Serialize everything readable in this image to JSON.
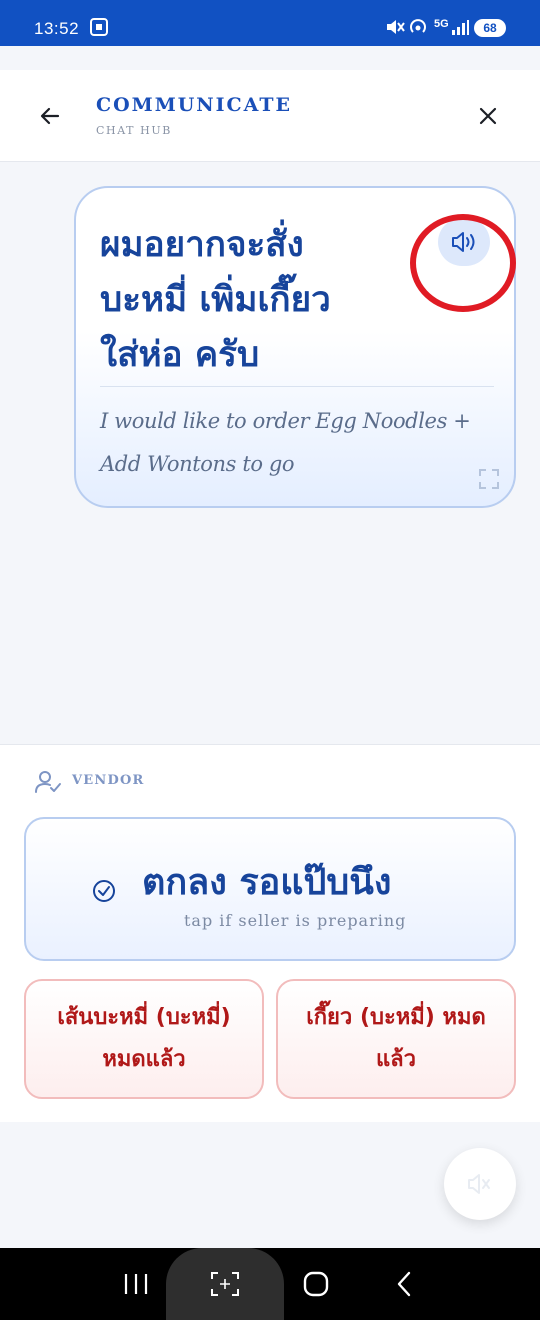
{
  "status_bar": {
    "time": "13:52",
    "network": "5G",
    "battery": "68"
  },
  "header": {
    "title": "COMMUNICATE",
    "subtitle": "CHAT HUB"
  },
  "phrase_card": {
    "thai_lines": [
      "ผมอยากจะสั่ง",
      "บะหมี่ เพิ่มเกี๊ยว",
      "ใส่ห่อ ครับ"
    ],
    "english_lines": [
      "I would like to order Egg Noodles +",
      "Add Wontons to go"
    ]
  },
  "vendor": {
    "label": "VENDOR",
    "confirm": {
      "thai": "ตกลง รอแป๊บนึง",
      "hint": "tap if seller is preparing"
    },
    "sold_out_options": [
      "เส้นบะหมี่ (บะหมี่) หมดแล้ว",
      "เกี๊ยว (บะหมี่) หมดแล้ว"
    ]
  },
  "colors": {
    "status_bar": "#1151c2",
    "primary": "#17449b",
    "accent": "#1a4fb8",
    "danger": "#b01818",
    "annotation": "#e01b24"
  },
  "icons": [
    "back-arrow-icon",
    "close-icon",
    "speaker-icon",
    "expand-icon",
    "vendor-user-check-icon",
    "check-circle-icon",
    "speaker-fab-icon"
  ]
}
